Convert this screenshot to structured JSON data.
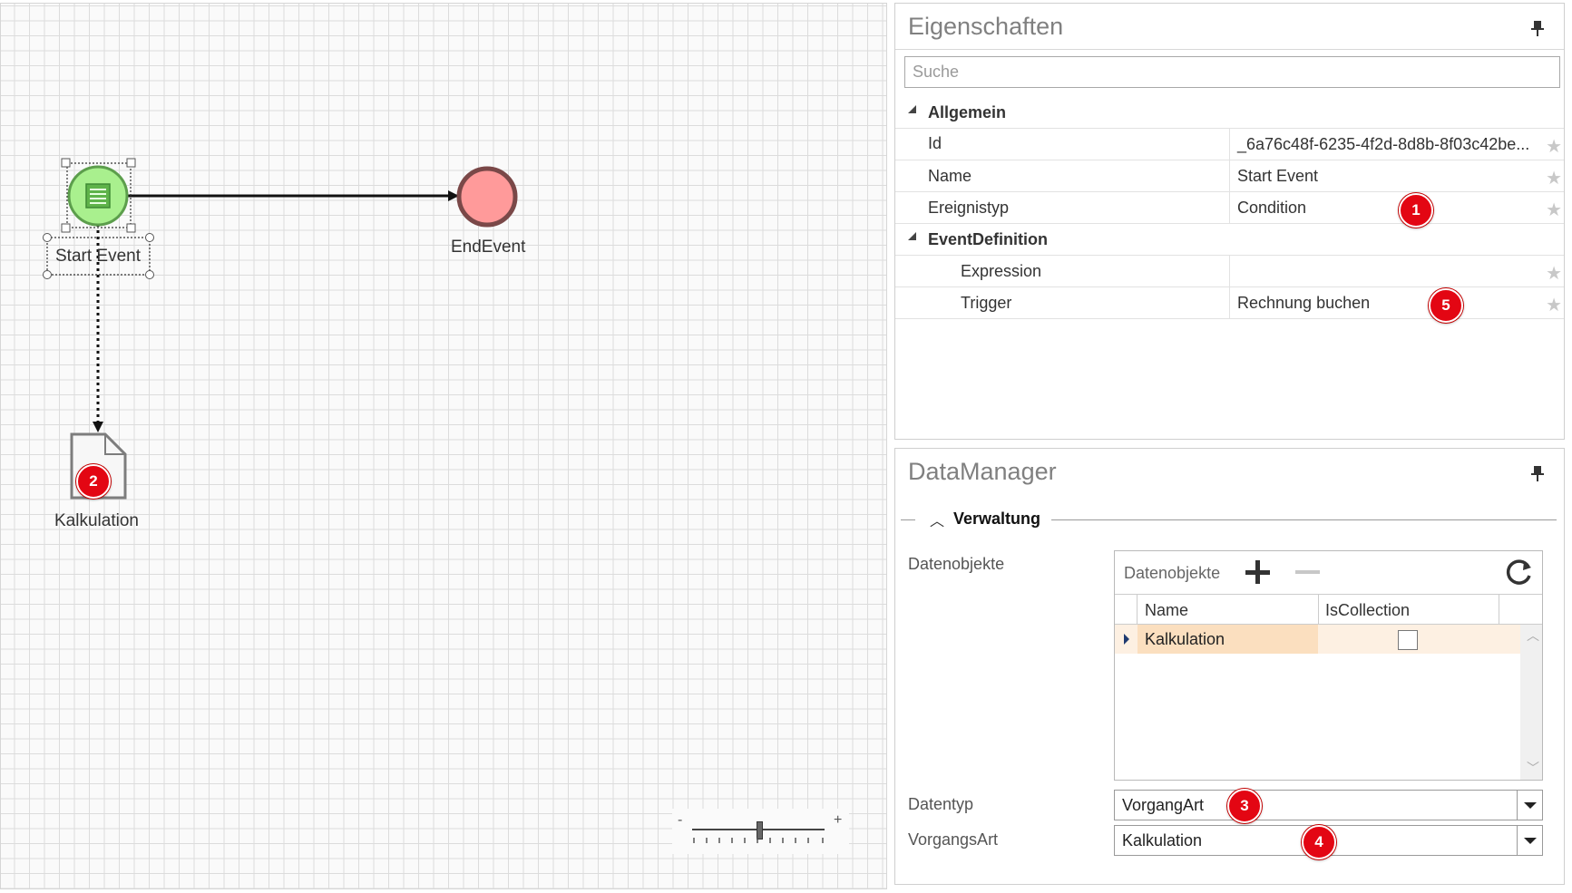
{
  "canvas": {
    "start_event_label": "Start Event",
    "end_event_label": "EndEvent",
    "data_object_label": "Kalkulation",
    "zoom": {
      "minus": "-",
      "plus": "+"
    }
  },
  "badges": {
    "b1": "1",
    "b2": "2",
    "b3": "3",
    "b4": "4",
    "b5": "5"
  },
  "properties": {
    "title": "Eigenschaften",
    "search_placeholder": "Suche",
    "category_general": "Allgemein",
    "rows": {
      "id": {
        "name": "Id",
        "value": "_6a76c48f-6235-4f2d-8d8b-8f03c42be..."
      },
      "name": {
        "name": "Name",
        "value": "Start Event"
      },
      "event_type": {
        "name": "Ereignistyp",
        "value": "Condition"
      }
    },
    "category_event_definition": "EventDefinition",
    "event_rows": {
      "expression": {
        "name": "Expression",
        "value": ""
      },
      "trigger": {
        "name": "Trigger",
        "value": "Rechnung buchen"
      }
    }
  },
  "datamanager": {
    "title": "DataManager",
    "section": "Verwaltung",
    "objects_label": "Datenobjekte",
    "toolbar_label": "Datenobjekte",
    "columns": [
      "Name",
      "IsCollection"
    ],
    "rows": [
      {
        "name": "Kalkulation",
        "is_collection": false
      }
    ],
    "datatype_label": "Datentyp",
    "datatype_value": "VorgangArt",
    "kind_label": "VorgangsArt",
    "kind_value": "Kalkulation"
  },
  "colors": {
    "start_event_fill": "#a9f08e",
    "start_event_stroke": "#5c9e4c",
    "end_event_fill": "#ff9a9a",
    "end_event_stroke": "#7a4848",
    "badge": "#e30613",
    "selected_row": "#fbdfbf"
  }
}
